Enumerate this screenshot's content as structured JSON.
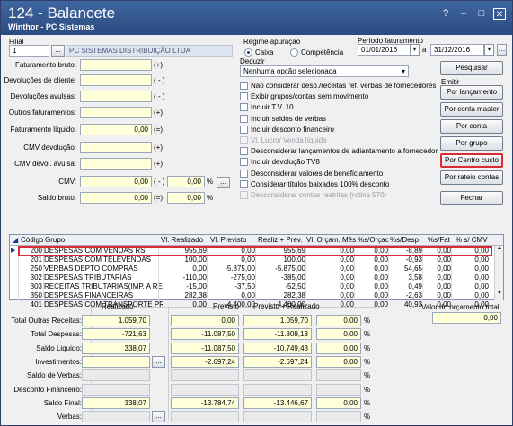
{
  "window": {
    "title": "124 - Balancete",
    "subtitle": "Winthor - PC Sistemas",
    "help": "?",
    "minimize": "–",
    "maximize": "□",
    "close": "✕"
  },
  "filial": {
    "label": "Filial",
    "code": "1",
    "name": "PC SISTEMAS DISTRIBUIÇÃO LTDA"
  },
  "regime": {
    "label": "Regime apuração",
    "options": [
      "Caixa",
      "Competência"
    ],
    "selected": "Caixa"
  },
  "periodo": {
    "label": "Período faturamento",
    "start": "01/01/2016",
    "sep": "a",
    "end": "31/12/2016"
  },
  "deduzir": {
    "label": "Deduzir",
    "value": "Nenhuma opção selecionada"
  },
  "left_fields": [
    {
      "label": "Faturamento bruto:",
      "value": "",
      "sign": "(+)"
    },
    {
      "label": "Devoluções de cliente:",
      "value": "",
      "sign": "( - )"
    },
    {
      "label": "Devoluções avulsas:",
      "value": "",
      "sign": "( - )"
    },
    {
      "label": "Outros faturamentos:",
      "value": "",
      "sign": "(+)"
    },
    {
      "label": "Faturamento líquido:",
      "value": "0,00",
      "sign": "(=)"
    },
    {
      "label": "CMV devolução:",
      "value": "",
      "sign": "(+)"
    },
    {
      "label": "CMV devol. avulsa:",
      "value": "",
      "sign": "(+)"
    },
    {
      "label": "CMV:",
      "value": "0,00",
      "sign": "( - )",
      "pct": "0,00",
      "pct_sign": "%"
    },
    {
      "label": "Saldo bruto:",
      "value": "0,00",
      "sign": "(=)",
      "pct": "0,00",
      "pct_sign": "%"
    }
  ],
  "options": [
    {
      "label": "Não considerar desp./receitas ref. verbas de fornecedores",
      "enabled": true
    },
    {
      "label": "Exibir grupos/contas sem movimento",
      "enabled": true
    },
    {
      "label": "Incluir T.V. 10",
      "enabled": true
    },
    {
      "label": "Incluir saldos de verbas",
      "enabled": true
    },
    {
      "label": "Incluir desconto financeiro",
      "enabled": true
    },
    {
      "label": "Vl. Lucro/ Venda líquida",
      "enabled": false
    },
    {
      "label": "Desconsiderar lançamentos de adiantamento a fornecedor",
      "enabled": true
    },
    {
      "label": "Incluir devolução TV8",
      "enabled": true
    },
    {
      "label": "Desconsiderar valores de beneficiamento",
      "enabled": true
    },
    {
      "label": "Considerar títulos baixados 100% desconto",
      "enabled": true
    },
    {
      "label": "Desconsiderar contas restritas (rotina 570)",
      "enabled": false
    }
  ],
  "buttons": {
    "pesquisar": "Pesquisar",
    "emitir_label": "Emitir",
    "lancamento": "Por lançamento",
    "conta_master": "Por conta master",
    "conta": "Por conta",
    "grupo": "Por grupo",
    "centro_custo": "Por Centro custo",
    "rateio": "Por rateio contas",
    "fechar": "Fechar"
  },
  "grid": {
    "headers": [
      "Código",
      "Grupo",
      "Vl. Realizado",
      "Vl. Previsto",
      "Realiz + Prev.",
      "Vl. Orçam. Mês",
      "%s/Orçac",
      "%s/Desp",
      "%s/Fat",
      "% s/ CMV"
    ],
    "rows": [
      [
        "200",
        "DESPESAS COM VENDAS RS",
        "955,69",
        "0,00",
        "955,69",
        "0,00",
        "0,00",
        "-8,89",
        "0,00",
        "0,00"
      ],
      [
        "201",
        "DESPESAS COM TELEVENDAS",
        "100,00",
        "0,00",
        "100,00",
        "0,00",
        "0,00",
        "-0,93",
        "0,00",
        "0,00"
      ],
      [
        "250",
        "VERBAS DEPTO COMPRAS",
        "0,00",
        "-5.875,00",
        "-5.875,00",
        "0,00",
        "0,00",
        "54,65",
        "0,00",
        "0,00"
      ],
      [
        "302",
        "DESPESAS TRIBUTARIAS",
        "-110,00",
        "-275,00",
        "-385,00",
        "0,00",
        "0,00",
        "3,58",
        "0,00",
        "0,00"
      ],
      [
        "303",
        "RECEITAS TRIBUTARIAS(IMP. A RECI",
        "-15,00",
        "-37,50",
        "-52,50",
        "0,00",
        "0,00",
        "0,49",
        "0,00",
        "0,00"
      ],
      [
        "350",
        "DESPESAS FINANCEIRAS",
        "282,38",
        "0,00",
        "282,38",
        "0,00",
        "0,00",
        "-2,63",
        "0,00",
        "0,00"
      ],
      [
        "401",
        "DESPESAS COM TRANSPORTE PROPR",
        "0,00",
        "-4.400,00",
        "-4.400,00",
        "0,00",
        "0,00",
        "40,93",
        "0,00",
        "0,00"
      ]
    ]
  },
  "totals": {
    "col_realizado": "Realizado",
    "col_previsto": "Previsto",
    "col_prev_real": "Previsto + Realizado",
    "orcamento_label": "Valor do orçamento total",
    "orcamento_value": "0,00",
    "rows": [
      {
        "label": "Total Outras Receitas:",
        "realizado": "1.059,70",
        "previsto": "0,00",
        "prev_real": "1.059,70",
        "pct": "0,00"
      },
      {
        "label": "Total Despesas:",
        "realizado": "-721,63",
        "previsto": "-11.087,50",
        "prev_real": "-11.809,13",
        "pct": "0,00"
      },
      {
        "label": "Saldo Liquido:",
        "realizado": "338,07",
        "previsto": "-11.087,50",
        "prev_real": "-10.749,43",
        "pct": "0,00"
      },
      {
        "label": "Investimentos:",
        "realizado": "",
        "previsto": "-2.697,24",
        "prev_real": "-2.697,24",
        "pct": "0,00"
      },
      {
        "label": "Saldo de Verbas:",
        "realizado": "",
        "previsto": "",
        "prev_real": "",
        "pct": ""
      },
      {
        "label": "Desconto Financeiro:",
        "realizado": "",
        "previsto": "",
        "prev_real": "",
        "pct": ""
      },
      {
        "label": "Saldo Final:",
        "realizado": "338,07",
        "previsto": "-13.784,74",
        "prev_real": "-13.446,67",
        "pct": "0,00"
      },
      {
        "label": "Verbas:",
        "realizado": "",
        "previsto": "",
        "prev_real": "",
        "pct": ""
      }
    ],
    "pct_sign": "%"
  }
}
